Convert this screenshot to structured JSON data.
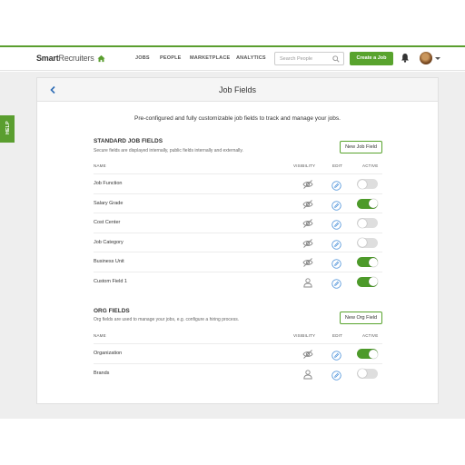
{
  "brand": {
    "name_bold": "Smart",
    "name_light": "Recruiters"
  },
  "nav": [
    "JOBS",
    "PEOPLE",
    "MARKETPLACE",
    "ANALYTICS"
  ],
  "search": {
    "placeholder": "Search People"
  },
  "header": {
    "create_job_label": "Create a Job"
  },
  "help_label": "HELP",
  "page": {
    "title": "Job Fields",
    "intro": "Pre-configured and fully customizable job fields to track and manage your jobs."
  },
  "columns": {
    "name": "NAME",
    "visibility": "VISIBILITY",
    "edit": "EDIT",
    "active": "ACTIVE"
  },
  "standard": {
    "title": "STANDARD JOB FIELDS",
    "subtitle": "Secure fields are displayed internally, public fields internally and externally.",
    "button_label": "New Job Field",
    "rows": [
      {
        "name": "Job Function",
        "visibility": "hidden-eye-icon",
        "active": false
      },
      {
        "name": "Salary Grade",
        "visibility": "hidden-eye-icon",
        "active": true
      },
      {
        "name": "Cost Center",
        "visibility": "hidden-eye-icon",
        "active": false
      },
      {
        "name": "Job Category",
        "visibility": "hidden-eye-icon",
        "active": false
      },
      {
        "name": "Business Unit",
        "visibility": "hidden-eye-icon",
        "active": true
      },
      {
        "name": "Custom Field 1",
        "visibility": "person-icon",
        "active": true
      }
    ]
  },
  "org": {
    "title": "ORG FIELDS",
    "subtitle": "Org fields are used to manage your jobs, e.g. configure a hiring process.",
    "button_label": "New Org Field",
    "rows": [
      {
        "name": "Organization",
        "visibility": "hidden-eye-icon",
        "active": true
      },
      {
        "name": "Brands",
        "visibility": "person-icon",
        "active": false
      }
    ]
  },
  "colors": {
    "accent": "#58a32d",
    "edit_icon": "#4a90d9",
    "toggle_off": "#dedede"
  }
}
